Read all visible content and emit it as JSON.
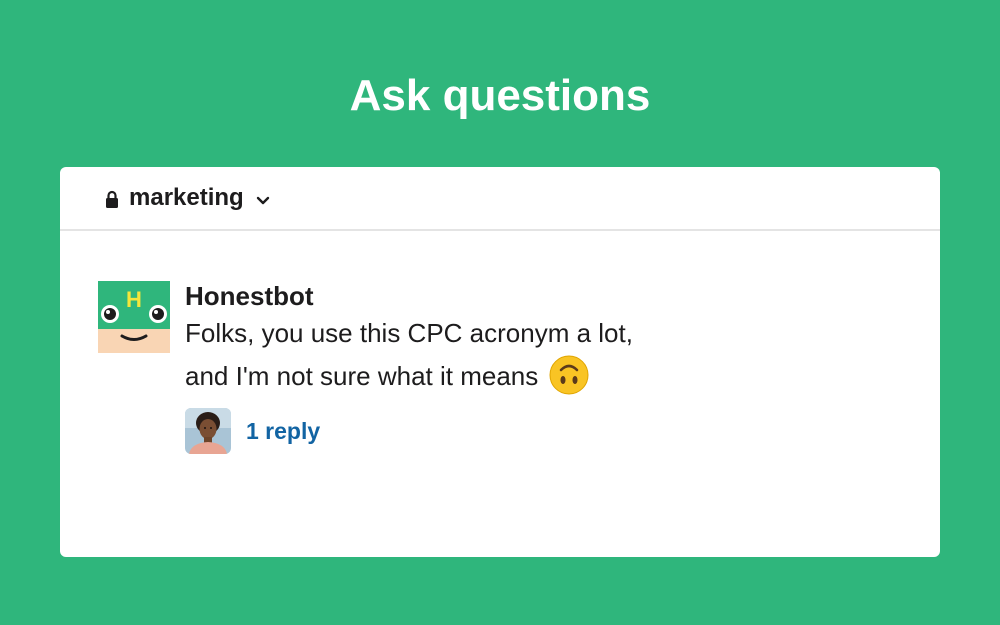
{
  "headline": "Ask questions",
  "channel": {
    "name": "marketing",
    "icon": "lock-icon",
    "dropdown_icon": "chevron-down-icon"
  },
  "message": {
    "sender": "Honestbot",
    "avatar_letter": "H",
    "text_line1": "Folks, you use this CPC acronym a lot,",
    "text_line2": "and I'm not sure what it means",
    "emoji": "upside-down-face-icon",
    "thread": {
      "reply_label": "1 reply"
    }
  },
  "colors": {
    "background": "#2fb67c",
    "link": "#1264a3",
    "text": "#1d1c1d"
  }
}
